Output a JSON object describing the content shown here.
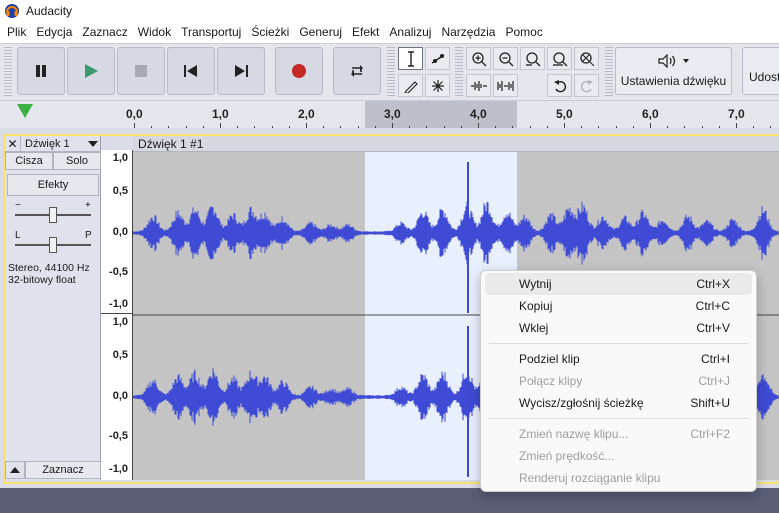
{
  "window": {
    "title": "Audacity"
  },
  "menubar": [
    "Plik",
    "Edycja",
    "Zaznacz",
    "Widok",
    "Transportuj",
    "Ścieżki",
    "Generuj",
    "Efekt",
    "Analizuj",
    "Narzędzia",
    "Pomoc"
  ],
  "toolbar": {
    "audio_setup_label": "Ustawienia dźwięku",
    "share_label": "Udost"
  },
  "timeline": {
    "ticks": [
      "0,0",
      "1,0",
      "2,0",
      "3,0",
      "4,0",
      "5,0",
      "6,0",
      "7,0"
    ]
  },
  "track": {
    "name": "Dźwięk 1",
    "mute": "Cisza",
    "solo": "Solo",
    "effects": "Efekty",
    "gain_minus": "−",
    "gain_plus": "+",
    "pan_left": "L",
    "pan_right": "P",
    "info_line1": "Stereo, 44100 Hz",
    "info_line2": "32-bitowy float",
    "select": "Zaznacz",
    "clip_name": "Dźwięk 1 #1",
    "vticks_top": [
      "1,0",
      "0,5",
      "0,0",
      "-0,5",
      "-1,0"
    ],
    "vticks_bottom": [
      "1,0",
      "0,5",
      "0,0",
      "-0,5",
      "-1,0"
    ]
  },
  "colors": {
    "wave": "#3f4bd4",
    "selection": "#e8effd",
    "clip_bg": "#c4c4c4",
    "track_border": "#f7e36a",
    "play": "#3cb043",
    "record": "#c62828"
  },
  "context_menu": {
    "items": [
      {
        "label": "Wytnij",
        "shortcut": "Ctrl+X",
        "state": "hover"
      },
      {
        "label": "Kopiuj",
        "shortcut": "Ctrl+C",
        "state": "enabled"
      },
      {
        "label": "Wklej",
        "shortcut": "Ctrl+V",
        "state": "enabled"
      },
      {
        "sep": true
      },
      {
        "label": "Podziel klip",
        "shortcut": "Ctrl+I",
        "state": "enabled"
      },
      {
        "label": "Połącz klipy",
        "shortcut": "Ctrl+J",
        "state": "disabled"
      },
      {
        "label": "Wycisz/zgłośnij ścieżkę",
        "shortcut": "Shift+U",
        "state": "enabled"
      },
      {
        "sep": true
      },
      {
        "label": "Zmień nazwę klipu...",
        "shortcut": "Ctrl+F2",
        "state": "disabled"
      },
      {
        "label": "Zmień prędkość...",
        "shortcut": "",
        "state": "disabled"
      },
      {
        "label": "Renderuj rozciąganie klipu",
        "shortcut": "",
        "state": "disabled"
      }
    ]
  }
}
